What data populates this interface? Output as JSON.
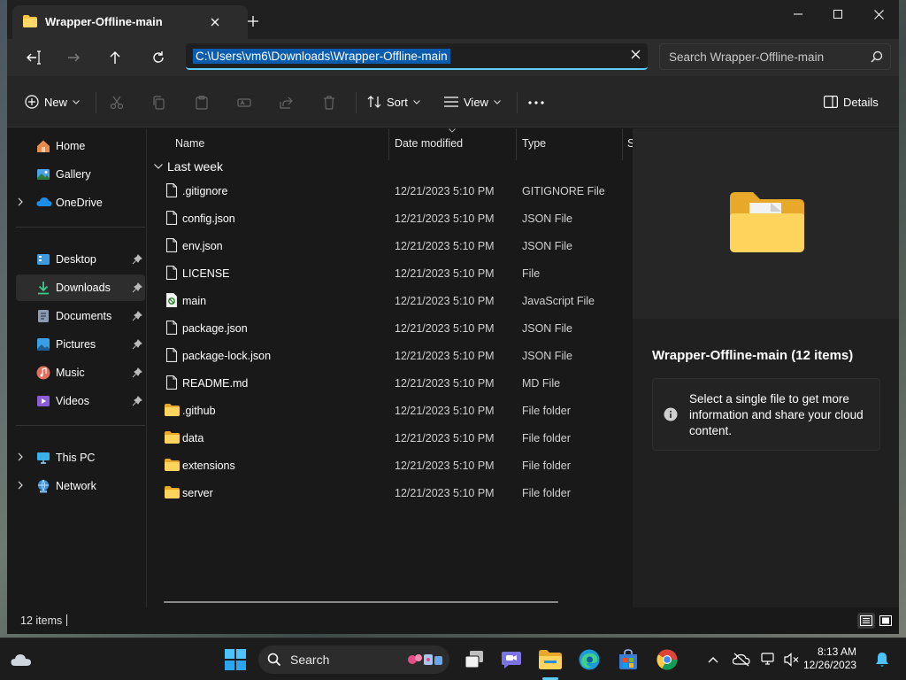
{
  "tab": {
    "title": "Wrapper-Offline-main"
  },
  "address": {
    "path": "C:\\Users\\vm6\\Downloads\\Wrapper-Offline-main"
  },
  "search": {
    "placeholder": "Search Wrapper-Offline-main"
  },
  "commands": {
    "new": "New",
    "sort": "Sort",
    "view": "View",
    "details": "Details"
  },
  "sidebar": {
    "home": "Home",
    "gallery": "Gallery",
    "onedrive": "OneDrive",
    "desktop": "Desktop",
    "downloads": "Downloads",
    "documents": "Documents",
    "pictures": "Pictures",
    "music": "Music",
    "videos": "Videos",
    "thispc": "This PC",
    "network": "Network"
  },
  "columns": {
    "name": "Name",
    "date": "Date modified",
    "type": "Type",
    "size": "S"
  },
  "group": {
    "label": "Last week"
  },
  "files": [
    {
      "name": ".gitignore",
      "date": "12/21/2023 5:10 PM",
      "type": "GITIGNORE File",
      "icon": "file"
    },
    {
      "name": "config.json",
      "date": "12/21/2023 5:10 PM",
      "type": "JSON File",
      "icon": "file"
    },
    {
      "name": "env.json",
      "date": "12/21/2023 5:10 PM",
      "type": "JSON File",
      "icon": "file"
    },
    {
      "name": "LICENSE",
      "date": "12/21/2023 5:10 PM",
      "type": "File",
      "icon": "file"
    },
    {
      "name": "main",
      "date": "12/21/2023 5:10 PM",
      "type": "JavaScript File",
      "icon": "script"
    },
    {
      "name": "package.json",
      "date": "12/21/2023 5:10 PM",
      "type": "JSON File",
      "icon": "file"
    },
    {
      "name": "package-lock.json",
      "date": "12/21/2023 5:10 PM",
      "type": "JSON File",
      "icon": "file"
    },
    {
      "name": "README.md",
      "date": "12/21/2023 5:10 PM",
      "type": "MD File",
      "icon": "file"
    },
    {
      "name": ".github",
      "date": "12/21/2023 5:10 PM",
      "type": "File folder",
      "icon": "folder"
    },
    {
      "name": "data",
      "date": "12/21/2023 5:10 PM",
      "type": "File folder",
      "icon": "folder"
    },
    {
      "name": "extensions",
      "date": "12/21/2023 5:10 PM",
      "type": "File folder",
      "icon": "folder"
    },
    {
      "name": "server",
      "date": "12/21/2023 5:10 PM",
      "type": "File folder",
      "icon": "folder"
    }
  ],
  "details": {
    "title": "Wrapper-Offline-main (12 items)",
    "info": "Select a single file to get more information and share your cloud content."
  },
  "status": {
    "count": "12 items"
  },
  "taskbar": {
    "search": "Search",
    "time": "8:13 AM",
    "date": "12/26/2023"
  },
  "colors": {
    "accent": "#60cdff",
    "folder": "#f6c343",
    "selection": "#0b5cad"
  }
}
